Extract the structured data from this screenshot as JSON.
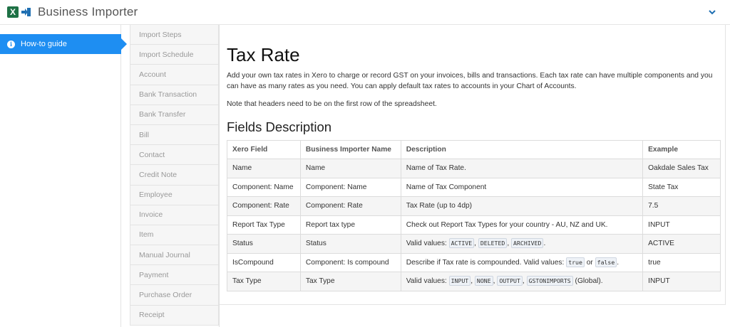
{
  "app": {
    "title": "Business Importer",
    "logo_letter": "X"
  },
  "leftnav": {
    "active_item": "How-to guide"
  },
  "subnav": {
    "items": [
      "Import Steps",
      "Import Schedule",
      "Account",
      "Bank Transaction",
      "Bank Transfer",
      "Bill",
      "Contact",
      "Credit Note",
      "Employee",
      "Invoice",
      "Item",
      "Manual Journal",
      "Payment",
      "Purchase Order",
      "Receipt"
    ]
  },
  "page": {
    "title": "Tax Rate",
    "intro": "Add your own tax rates in Xero to charge or record GST on your invoices, bills and transactions. Each tax rate can have multiple components and you can have as many rates as you need. You can apply default tax rates to accounts in your Chart of Accounts.",
    "note": "Note that headers need to be on the first row of the spreadsheet.",
    "fields_heading": "Fields Description"
  },
  "table": {
    "headers": [
      "Xero Field",
      "Business Importer Name",
      "Description",
      "Example"
    ],
    "rows": [
      {
        "xero": "Name",
        "bi": "Name",
        "desc": [
          {
            "t": "Name of Tax Rate."
          }
        ],
        "example": "Oakdale Sales Tax"
      },
      {
        "xero": "Component: Name",
        "bi": "Component: Name",
        "desc": [
          {
            "t": "Name of Tax Component"
          }
        ],
        "example": "State Tax"
      },
      {
        "xero": "Component: Rate",
        "bi": "Component: Rate",
        "desc": [
          {
            "t": "Tax Rate (up to 4dp)"
          }
        ],
        "example": "7.5"
      },
      {
        "xero": "Report Tax Type",
        "bi": "Report tax type",
        "desc": [
          {
            "t": "Check out Report Tax Types for your country - AU, NZ and UK."
          }
        ],
        "example": "INPUT"
      },
      {
        "xero": "Status",
        "bi": "Status",
        "desc": [
          {
            "t": "Valid values: "
          },
          {
            "c": "ACTIVE"
          },
          {
            "t": ", "
          },
          {
            "c": "DELETED"
          },
          {
            "t": ", "
          },
          {
            "c": "ARCHIVED"
          },
          {
            "t": "."
          }
        ],
        "example": "ACTIVE"
      },
      {
        "xero": "IsCompound",
        "bi": "Component: Is compound",
        "desc": [
          {
            "t": "Describe if Tax rate is compounded. Valid values: "
          },
          {
            "c": "true"
          },
          {
            "t": " or "
          },
          {
            "c": "false"
          },
          {
            "t": "."
          }
        ],
        "example": "true"
      },
      {
        "xero": "Tax Type",
        "bi": "Tax Type",
        "desc": [
          {
            "t": "Valid values: "
          },
          {
            "c": "INPUT"
          },
          {
            "t": ", "
          },
          {
            "c": "NONE"
          },
          {
            "t": ", "
          },
          {
            "c": "OUTPUT"
          },
          {
            "t": ", "
          },
          {
            "c": "GSTONIMPORTS"
          },
          {
            "t": " (Global)."
          }
        ],
        "example": "INPUT"
      }
    ]
  }
}
